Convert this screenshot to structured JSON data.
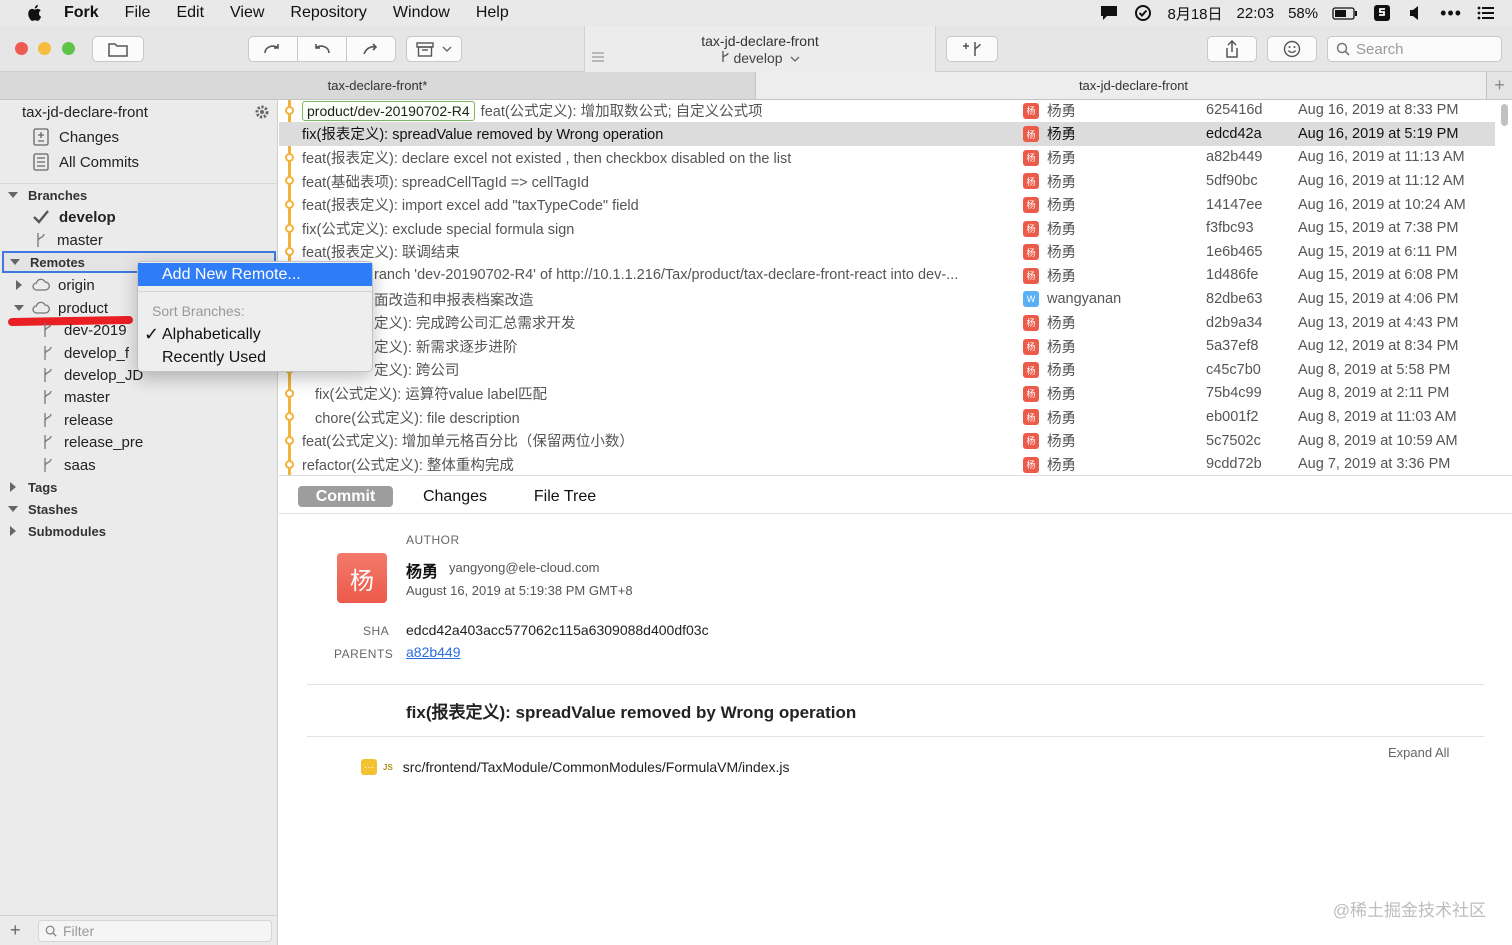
{
  "menubar": {
    "app_name": "Fork",
    "items": [
      "File",
      "Edit",
      "View",
      "Repository",
      "Window",
      "Help"
    ],
    "status": {
      "date": "8月18日",
      "time": "22:03",
      "battery": "58%"
    }
  },
  "toolbar": {
    "repo_title": "tax-jd-declare-front",
    "branch": "develop",
    "search_placeholder": "Search"
  },
  "tabs": [
    {
      "label": "tax-declare-front*"
    },
    {
      "label": "tax-jd-declare-front"
    }
  ],
  "sidebar": {
    "repo_name": "tax-jd-declare-front",
    "changes": "Changes",
    "all_commits": "All Commits",
    "branches_header": "Branches",
    "branches": [
      "develop",
      "master"
    ],
    "remotes_header": "Remotes",
    "remotes": [
      "origin",
      "product"
    ],
    "product_branches": [
      "dev-2019",
      "develop_f",
      "develop_JD",
      "master",
      "release",
      "release_pre",
      "saas"
    ],
    "tags_header": "Tags",
    "stashes_header": "Stashes",
    "submodules_header": "Submodules",
    "filter_placeholder": "Filter"
  },
  "context_menu": {
    "add_remote": "Add New Remote...",
    "sort_label": "Sort Branches:",
    "alphabetically": "Alphabetically",
    "recently_used": "Recently Used"
  },
  "commits": [
    {
      "tag": "product/dev-20190702-R4",
      "message": "feat(公式定义): 增加取数公式; 自定义公式项",
      "author": "杨勇",
      "avatar": "杨",
      "sha": "625416d",
      "date": "Aug 16, 2019 at 8:33 PM"
    },
    {
      "message": "fix(报表定义): spreadValue removed by Wrong operation",
      "author": "杨勇",
      "avatar": "杨",
      "sha": "edcd42a",
      "date": "Aug 16, 2019 at 5:19 PM"
    },
    {
      "message": "feat(报表定义): declare excel not existed , then checkbox disabled on the list",
      "author": "杨勇",
      "avatar": "杨",
      "sha": "a82b449",
      "date": "Aug 16, 2019 at 11:13 AM"
    },
    {
      "message": "feat(基础表项): spreadCellTagId => cellTagId",
      "author": "杨勇",
      "avatar": "杨",
      "sha": "5df90bc",
      "date": "Aug 16, 2019 at 11:12 AM"
    },
    {
      "message": "feat(报表定义): import excel add \"taxTypeCode\" field",
      "author": "杨勇",
      "avatar": "杨",
      "sha": "14147ee",
      "date": "Aug 16, 2019 at 10:24 AM"
    },
    {
      "message": "fix(公式定义): exclude special formula sign",
      "author": "杨勇",
      "avatar": "杨",
      "sha": "f3fbc93",
      "date": "Aug 15, 2019 at 7:38 PM"
    },
    {
      "message": "feat(报表定义): 联调结束",
      "author": "杨勇",
      "avatar": "杨",
      "sha": "1e6b465",
      "date": "Aug 15, 2019 at 6:11 PM"
    },
    {
      "message": "ranch 'dev-20190702-R4' of http://10.1.1.216/Tax/product/tax-declare-front-react into dev-...",
      "author": "杨勇",
      "avatar": "杨",
      "sha": "1d486fe",
      "date": "Aug 15, 2019 at 6:08 PM"
    },
    {
      "message": "面改造和申报表档案改造",
      "author": "wangyanan",
      "avatar": "W",
      "sha": "82dbe63",
      "date": "Aug 15, 2019 at 4:06 PM"
    },
    {
      "message": "定义): 完成跨公司汇总需求开发",
      "author": "杨勇",
      "avatar": "杨",
      "sha": "d2b9a34",
      "date": "Aug 13, 2019 at 4:43 PM"
    },
    {
      "message": "定义): 新需求逐步进阶",
      "author": "杨勇",
      "avatar": "杨",
      "sha": "5a37ef8",
      "date": "Aug 12, 2019 at 8:34 PM"
    },
    {
      "message": "定义): 跨公司",
      "author": "杨勇",
      "avatar": "杨",
      "sha": "c45c7b0",
      "date": "Aug 8, 2019 at 5:58 PM"
    },
    {
      "message": "fix(公式定义): 运算符value label匹配",
      "author": "杨勇",
      "avatar": "杨",
      "sha": "75b4c99",
      "date": "Aug 8, 2019 at 2:11 PM"
    },
    {
      "message": "chore(公式定义): file description",
      "author": "杨勇",
      "avatar": "杨",
      "sha": "eb001f2",
      "date": "Aug 8, 2019 at 11:03 AM"
    },
    {
      "message": "feat(公式定义): 增加单元格百分比（保留两位小数）",
      "author": "杨勇",
      "avatar": "杨",
      "sha": "5c7502c",
      "date": "Aug 8, 2019 at 10:59 AM"
    },
    {
      "message": "refactor(公式定义): 整体重构完成",
      "author": "杨勇",
      "avatar": "杨",
      "sha": "9cdd72b",
      "date": "Aug 7, 2019 at 3:36 PM"
    }
  ],
  "detail": {
    "tabs": [
      "Commit",
      "Changes",
      "File Tree"
    ],
    "author_label": "AUTHOR",
    "avatar": "杨",
    "author_name": "杨勇",
    "author_email": "yangyong@ele-cloud.com",
    "author_date": "August 16, 2019 at 5:19:38 PM GMT+8",
    "sha_label": "SHA",
    "sha": "edcd42a403acc577062c115a6309088d400df03c",
    "parents_label": "PARENTS",
    "parent": "a82b449",
    "message": "fix(报表定义): spreadValue removed by Wrong operation",
    "expand_all": "Expand All",
    "file_badge": "JS",
    "file_path": "src/frontend/TaxModule/CommonModules/FormulaVM/index.js"
  },
  "watermark": "@稀土掘金技术社区",
  "colors": {
    "accent": "#2f7df6",
    "graph": "#f3b33a",
    "avatar_red": "#ec5a4a",
    "avatar_blue": "#5ab0f5",
    "tag_border": "#7bb661"
  }
}
